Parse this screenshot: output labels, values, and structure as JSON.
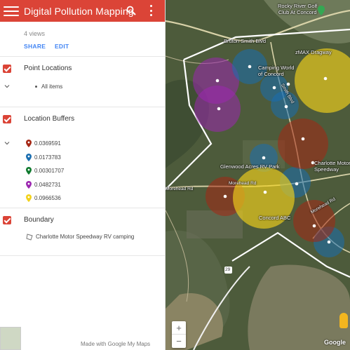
{
  "header": {
    "title": "Digital Pollution Mapping",
    "background": "#db4437"
  },
  "meta": {
    "views": "4 views",
    "share_label": "SHARE",
    "edit_label": "EDIT"
  },
  "layers": [
    {
      "title": "Point Locations",
      "items": [
        {
          "label": "All items"
        }
      ]
    },
    {
      "title": "Location Buffers",
      "items": [
        {
          "label": "0.0369591",
          "color": "#a52714"
        },
        {
          "label": "0.0173783",
          "color": "#1a6eb0"
        },
        {
          "label": "0.00301707",
          "color": "#0f7a2e"
        },
        {
          "label": "0.0482731",
          "color": "#9c27b0"
        },
        {
          "label": "0.0966536",
          "color": "#f2d21b"
        }
      ]
    },
    {
      "title": "Boundary",
      "items": [
        {
          "label": "Charlotte Motor Speedway RV camping"
        }
      ]
    }
  ],
  "footer": {
    "made_with": "Made with Google My Maps"
  },
  "map": {
    "labels": {
      "bruton_smith": "Bruton Smith Blvd",
      "rocky_river": "Rocky River Golf\nClub At Concord",
      "zmax": "zMAX Dragway",
      "camping_world": "Camping World\nof Concord",
      "smith_blvd": "Smith Blvd",
      "glenwood": "Glenwood Acres RV Park",
      "charlotte_motor": "Charlotte Motor\nSpeedway",
      "morehead_rd_1": "Morehead Rd",
      "morehead_rd_2": "Morehead Rd",
      "morehead_rd_3": "Morehead Rd",
      "concord_abc": "Concord ABC",
      "route_29": "29"
    },
    "zoom_in": "+",
    "zoom_out": "−",
    "google": "Google"
  }
}
